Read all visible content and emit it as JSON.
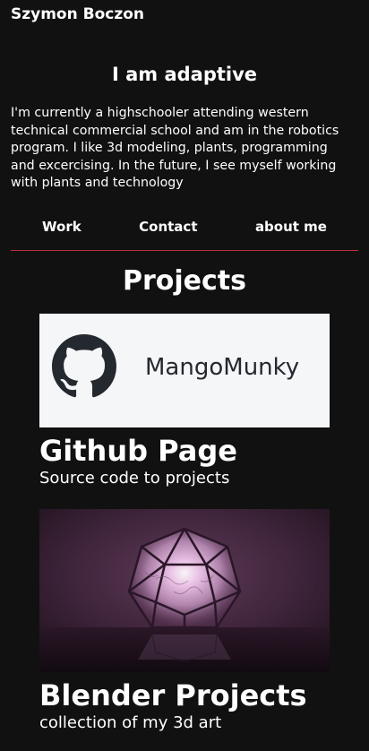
{
  "header": {
    "name": "Szymon Boczon"
  },
  "intro": {
    "tagline": "I am adaptive",
    "bio": "I'm currently a highschooler attending western technical commercial school and am in the robotics program. I like 3d modeling, plants, programming and excercising. In the future, I see myself working with plants and technology"
  },
  "nav": {
    "items": [
      {
        "label": "Work"
      },
      {
        "label": "Contact"
      },
      {
        "label": "about me"
      }
    ],
    "divider_color": "#b8323c"
  },
  "projects": {
    "title": "Projects",
    "cards": [
      {
        "thumbnail_text": "MangoMunky",
        "thumbnail_icon": "github-octocat-icon",
        "title": "Github Page",
        "subtitle": "Source code to projects"
      },
      {
        "thumbnail_icon": "glowing-polyhedron-image",
        "title": "Blender Projects",
        "subtitle": "collection of my 3d art"
      }
    ]
  },
  "colors": {
    "background": "#111111",
    "text": "#ffffff",
    "accent": "#b8323c"
  }
}
